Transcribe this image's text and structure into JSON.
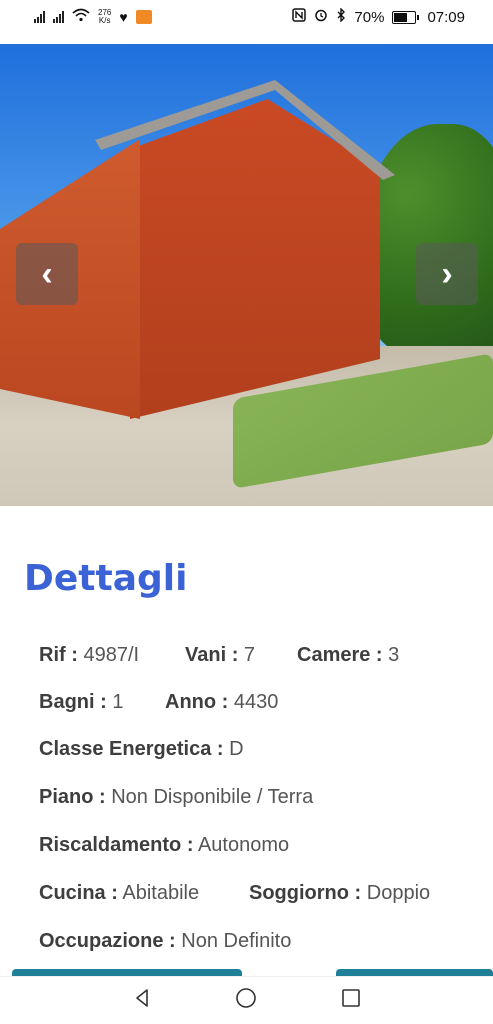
{
  "status_bar": {
    "net_speed_value": "276",
    "net_speed_unit": "K/s",
    "battery_percent": "70%",
    "time": "07:09"
  },
  "gallery": {
    "prev_glyph": "‹",
    "next_glyph": "›"
  },
  "details": {
    "title": "Dettagli",
    "rows": [
      [
        {
          "label": "Rif :",
          "value": "4987/I"
        },
        {
          "label": "Vani :",
          "value": "7"
        },
        {
          "label": "Camere :",
          "value": "3"
        }
      ],
      [
        {
          "label": "Bagni :",
          "value": "1"
        },
        {
          "label": "Anno :",
          "value": "4430"
        }
      ],
      [
        {
          "label": "Classe Energetica :",
          "value": "D"
        }
      ],
      [
        {
          "label": "Piano :",
          "value": "Non Disponibile / Terra"
        }
      ],
      [
        {
          "label": "Riscaldamento :",
          "value": "Autonomo"
        }
      ],
      [
        {
          "label": "Cucina :",
          "value": "Abitabile"
        },
        {
          "label": "Soggiorno :",
          "value": "Doppio"
        }
      ],
      [
        {
          "label": "Occupazione :",
          "value": "Non Definito"
        }
      ]
    ]
  },
  "colors": {
    "accent": "#3b63d6",
    "button": "#1e7f97"
  }
}
